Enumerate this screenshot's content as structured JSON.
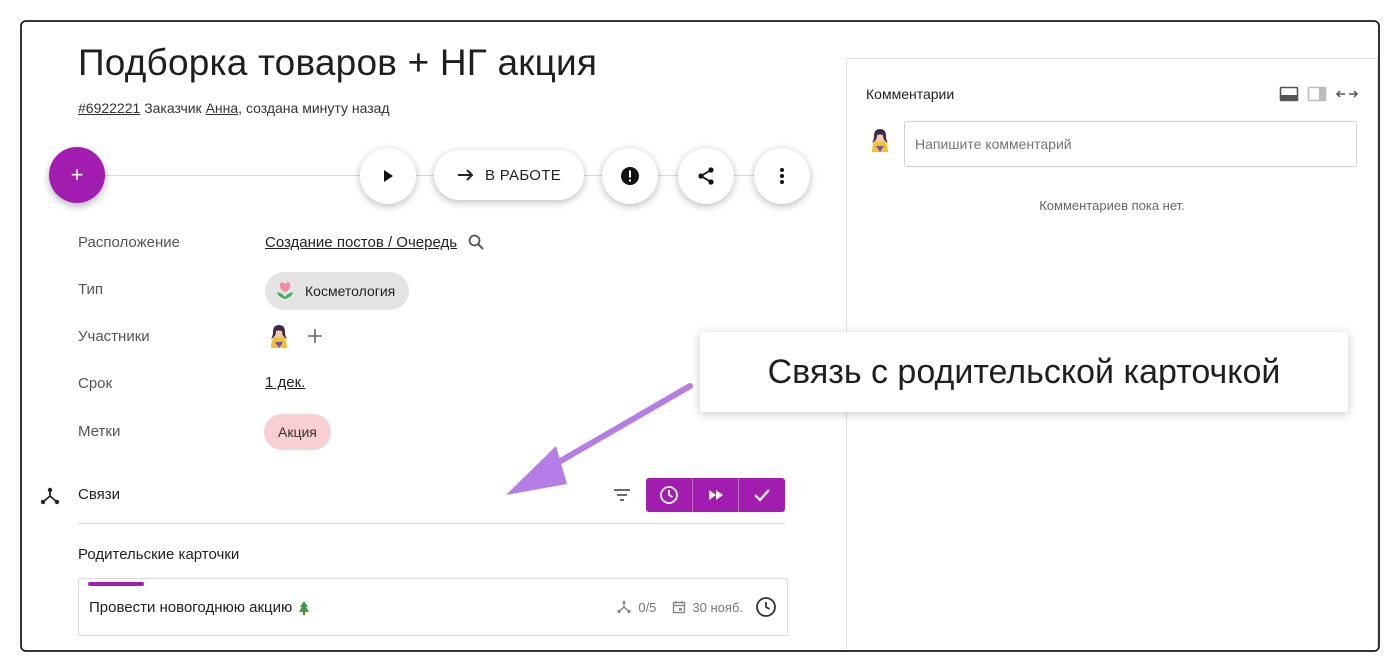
{
  "task": {
    "title": "Подборка товаров + НГ акция",
    "id_link": "#6922221",
    "customer_label": "Заказчик",
    "customer_name": "Анна",
    "created_text": ", создана минуту назад"
  },
  "toolbar": {
    "add_label": "+",
    "status_label": "В РАБОТЕ"
  },
  "fields": {
    "location_label": "Расположение",
    "location_value": "Создание постов / Очередь",
    "type_label": "Тип",
    "type_value": "Косметология",
    "members_label": "Участники",
    "due_label": "Срок",
    "due_value": "1 дек.",
    "tags_label": "Метки",
    "tag_value": "Акция"
  },
  "links": {
    "title": "Связи",
    "parent_title": "Родительские карточки",
    "parent_card": {
      "title": "Провести новогоднюю акцию",
      "subtasks": "0/5",
      "date": "30 нояб."
    }
  },
  "comments": {
    "title": "Комментарии",
    "placeholder": "Напишите комментарий",
    "empty_text": "Комментариев пока нет."
  },
  "callout": {
    "text": "Связь с родительской карточкой"
  },
  "colors": {
    "accent": "#a21caf",
    "tag_bg": "#f8cfd2",
    "chip_bg": "#e4e4e4",
    "arrow": "#b57ee6"
  },
  "icons": [
    "plus-icon",
    "play-icon",
    "arrow-right-icon",
    "alert-icon",
    "share-icon",
    "more-vert-icon",
    "search-icon",
    "tulip-icon",
    "avatar",
    "add-member-icon",
    "links-icon",
    "filter-icon",
    "clock-icon",
    "fast-forward-icon",
    "check-icon",
    "tree-icon",
    "subtasks-icon",
    "calendar-icon",
    "layout-bottom-icon",
    "layout-side-icon",
    "expand-horizontal-icon"
  ]
}
